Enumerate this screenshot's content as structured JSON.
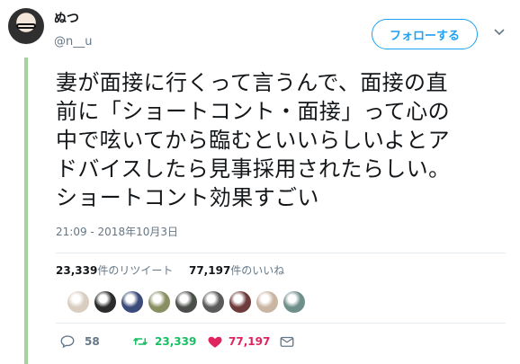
{
  "tweet": {
    "display_name": "ぬつ",
    "username": "@n__u",
    "follow_label": "フォローする",
    "text": "妻が面接に行くって言うんで、面接の直\n前に「ショートコント・面接」って心の\n中で呟いてから臨むといいらしいよとア\nドバイスしたら見事採用されたらしい。\nショートコント効果すごい",
    "timestamp": "21:09 - 2018年10月3日"
  },
  "stats": {
    "retweets": "23,339",
    "retweets_label": "件のリツイート",
    "likes": "77,197",
    "likes_label": "件のいいね"
  },
  "likers": [
    {
      "color": "#d9cdbf"
    },
    {
      "color": "#2b2b2b"
    },
    {
      "color": "#3a4a7a"
    },
    {
      "color": "#8a8f63"
    },
    {
      "color": "#4a4f4a"
    },
    {
      "color": "#5a5a5a"
    },
    {
      "color": "#6d3b3b"
    },
    {
      "color": "#c9b5a1"
    },
    {
      "color": "#6f8f8a"
    }
  ],
  "actions": {
    "replies": "58",
    "retweets": "23,339",
    "likes": "77,197"
  },
  "colors": {
    "accent": "#1da1f2",
    "retweet": "#17bf63",
    "like": "#e0245e",
    "muted": "#657786"
  },
  "icons": {
    "caret": "chevron-down-icon",
    "reply": "reply-icon",
    "retweet": "retweet-icon",
    "like": "heart-icon",
    "dm": "envelope-icon"
  }
}
